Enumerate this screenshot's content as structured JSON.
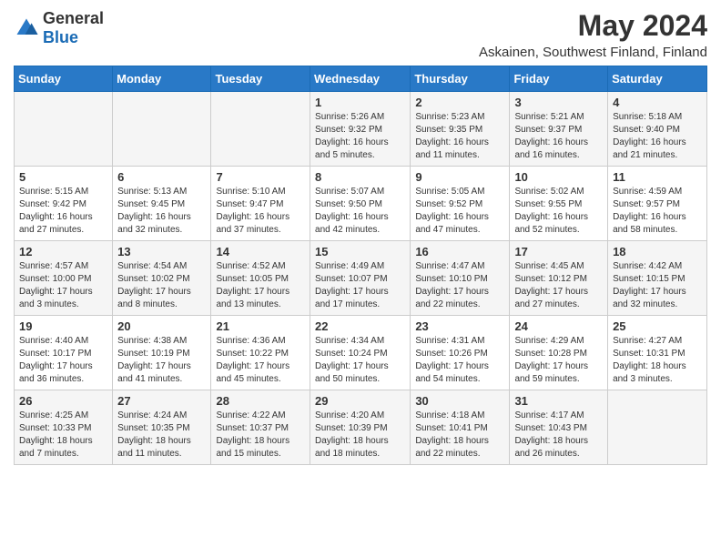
{
  "logo": {
    "text_general": "General",
    "text_blue": "Blue"
  },
  "header": {
    "title": "May 2024",
    "subtitle": "Askainen, Southwest Finland, Finland"
  },
  "days_of_week": [
    "Sunday",
    "Monday",
    "Tuesday",
    "Wednesday",
    "Thursday",
    "Friday",
    "Saturday"
  ],
  "weeks": [
    [
      {
        "day": "",
        "info": ""
      },
      {
        "day": "",
        "info": ""
      },
      {
        "day": "",
        "info": ""
      },
      {
        "day": "1",
        "info": "Sunrise: 5:26 AM\nSunset: 9:32 PM\nDaylight: 16 hours\nand 5 minutes."
      },
      {
        "day": "2",
        "info": "Sunrise: 5:23 AM\nSunset: 9:35 PM\nDaylight: 16 hours\nand 11 minutes."
      },
      {
        "day": "3",
        "info": "Sunrise: 5:21 AM\nSunset: 9:37 PM\nDaylight: 16 hours\nand 16 minutes."
      },
      {
        "day": "4",
        "info": "Sunrise: 5:18 AM\nSunset: 9:40 PM\nDaylight: 16 hours\nand 21 minutes."
      }
    ],
    [
      {
        "day": "5",
        "info": "Sunrise: 5:15 AM\nSunset: 9:42 PM\nDaylight: 16 hours\nand 27 minutes."
      },
      {
        "day": "6",
        "info": "Sunrise: 5:13 AM\nSunset: 9:45 PM\nDaylight: 16 hours\nand 32 minutes."
      },
      {
        "day": "7",
        "info": "Sunrise: 5:10 AM\nSunset: 9:47 PM\nDaylight: 16 hours\nand 37 minutes."
      },
      {
        "day": "8",
        "info": "Sunrise: 5:07 AM\nSunset: 9:50 PM\nDaylight: 16 hours\nand 42 minutes."
      },
      {
        "day": "9",
        "info": "Sunrise: 5:05 AM\nSunset: 9:52 PM\nDaylight: 16 hours\nand 47 minutes."
      },
      {
        "day": "10",
        "info": "Sunrise: 5:02 AM\nSunset: 9:55 PM\nDaylight: 16 hours\nand 52 minutes."
      },
      {
        "day": "11",
        "info": "Sunrise: 4:59 AM\nSunset: 9:57 PM\nDaylight: 16 hours\nand 58 minutes."
      }
    ],
    [
      {
        "day": "12",
        "info": "Sunrise: 4:57 AM\nSunset: 10:00 PM\nDaylight: 17 hours\nand 3 minutes."
      },
      {
        "day": "13",
        "info": "Sunrise: 4:54 AM\nSunset: 10:02 PM\nDaylight: 17 hours\nand 8 minutes."
      },
      {
        "day": "14",
        "info": "Sunrise: 4:52 AM\nSunset: 10:05 PM\nDaylight: 17 hours\nand 13 minutes."
      },
      {
        "day": "15",
        "info": "Sunrise: 4:49 AM\nSunset: 10:07 PM\nDaylight: 17 hours\nand 17 minutes."
      },
      {
        "day": "16",
        "info": "Sunrise: 4:47 AM\nSunset: 10:10 PM\nDaylight: 17 hours\nand 22 minutes."
      },
      {
        "day": "17",
        "info": "Sunrise: 4:45 AM\nSunset: 10:12 PM\nDaylight: 17 hours\nand 27 minutes."
      },
      {
        "day": "18",
        "info": "Sunrise: 4:42 AM\nSunset: 10:15 PM\nDaylight: 17 hours\nand 32 minutes."
      }
    ],
    [
      {
        "day": "19",
        "info": "Sunrise: 4:40 AM\nSunset: 10:17 PM\nDaylight: 17 hours\nand 36 minutes."
      },
      {
        "day": "20",
        "info": "Sunrise: 4:38 AM\nSunset: 10:19 PM\nDaylight: 17 hours\nand 41 minutes."
      },
      {
        "day": "21",
        "info": "Sunrise: 4:36 AM\nSunset: 10:22 PM\nDaylight: 17 hours\nand 45 minutes."
      },
      {
        "day": "22",
        "info": "Sunrise: 4:34 AM\nSunset: 10:24 PM\nDaylight: 17 hours\nand 50 minutes."
      },
      {
        "day": "23",
        "info": "Sunrise: 4:31 AM\nSunset: 10:26 PM\nDaylight: 17 hours\nand 54 minutes."
      },
      {
        "day": "24",
        "info": "Sunrise: 4:29 AM\nSunset: 10:28 PM\nDaylight: 17 hours\nand 59 minutes."
      },
      {
        "day": "25",
        "info": "Sunrise: 4:27 AM\nSunset: 10:31 PM\nDaylight: 18 hours\nand 3 minutes."
      }
    ],
    [
      {
        "day": "26",
        "info": "Sunrise: 4:25 AM\nSunset: 10:33 PM\nDaylight: 18 hours\nand 7 minutes."
      },
      {
        "day": "27",
        "info": "Sunrise: 4:24 AM\nSunset: 10:35 PM\nDaylight: 18 hours\nand 11 minutes."
      },
      {
        "day": "28",
        "info": "Sunrise: 4:22 AM\nSunset: 10:37 PM\nDaylight: 18 hours\nand 15 minutes."
      },
      {
        "day": "29",
        "info": "Sunrise: 4:20 AM\nSunset: 10:39 PM\nDaylight: 18 hours\nand 18 minutes."
      },
      {
        "day": "30",
        "info": "Sunrise: 4:18 AM\nSunset: 10:41 PM\nDaylight: 18 hours\nand 22 minutes."
      },
      {
        "day": "31",
        "info": "Sunrise: 4:17 AM\nSunset: 10:43 PM\nDaylight: 18 hours\nand 26 minutes."
      },
      {
        "day": "",
        "info": ""
      }
    ]
  ]
}
